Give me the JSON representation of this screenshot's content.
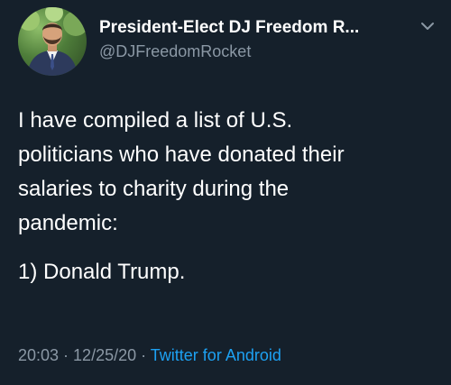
{
  "author": {
    "display_name": "President-Elect DJ Freedom R...",
    "handle": "@DJFreedomRocket"
  },
  "tweet": {
    "lines": [
      "I have compiled a list of U.S.",
      "politicians who have donated their",
      "salaries to charity during the",
      "pandemic:"
    ],
    "list_item": "1) Donald Trump."
  },
  "meta": {
    "time": "20:03",
    "separator": " · ",
    "date": "12/25/20",
    "source": "Twitter for Android"
  },
  "icons": {
    "more": "chevron-down-icon",
    "avatar": "avatar"
  },
  "colors": {
    "background": "#15202b",
    "text": "#ffffff",
    "secondary_text": "#8b98a5",
    "link": "#1da1f2"
  }
}
